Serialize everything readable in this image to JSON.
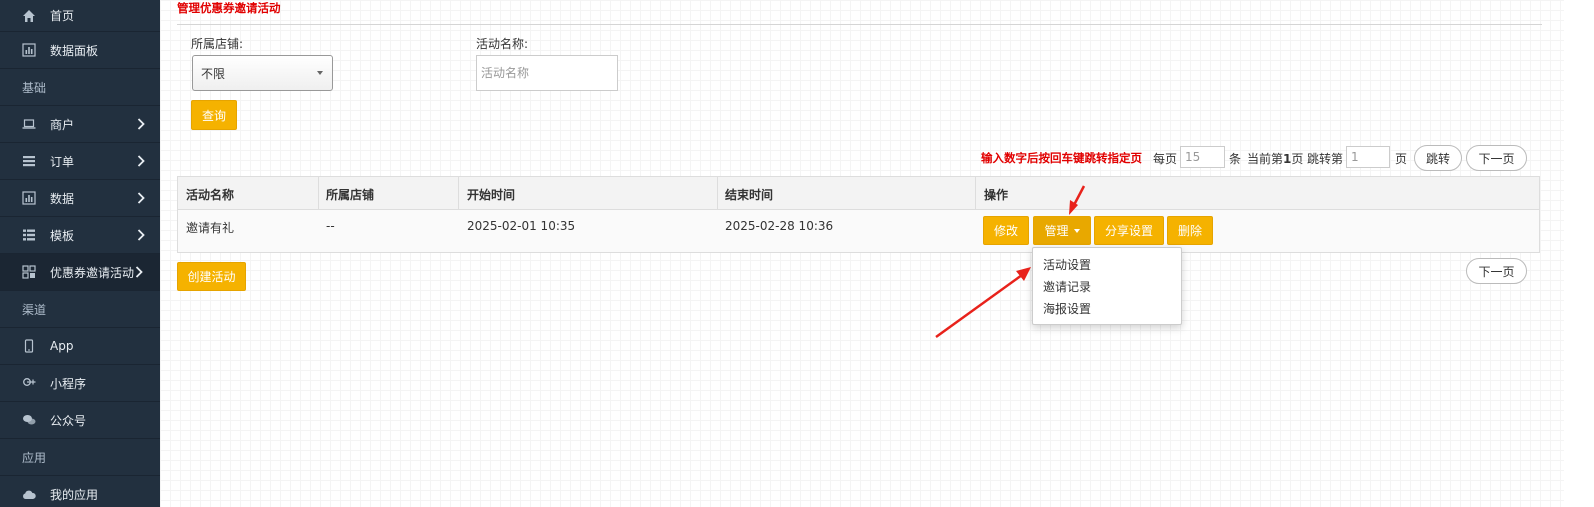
{
  "sidebar": {
    "items": [
      {
        "label": "首页",
        "icon": "home-icon"
      },
      {
        "label": "数据面板",
        "icon": "bar-chart-icon"
      },
      {
        "section": "基础"
      },
      {
        "label": "商户",
        "icon": "laptop-icon"
      },
      {
        "label": "订单",
        "icon": "list-icon"
      },
      {
        "label": "数据",
        "icon": "bar-chart-icon"
      },
      {
        "label": "模板",
        "icon": "table-list-icon"
      },
      {
        "label": "优惠券邀请活动",
        "icon": "grid-icon"
      },
      {
        "section": "渠道"
      },
      {
        "label": "App",
        "icon": "mobile-icon"
      },
      {
        "label": "小程序",
        "icon": "google-plus-icon"
      },
      {
        "label": "公众号",
        "icon": "chat-bubbles-icon"
      },
      {
        "section": "应用"
      },
      {
        "label": "我的应用",
        "icon": "cloud-icon"
      }
    ]
  },
  "page": {
    "title": "管理优惠券邀请活动"
  },
  "filters": {
    "store_label": "所属店铺:",
    "store_value": "不限",
    "activity_label": "活动名称:",
    "activity_placeholder": "活动名称",
    "query_button": "查询"
  },
  "pager": {
    "hint": "输入数字后按回车键跳转指定页",
    "per_page_prefix": "每页",
    "per_page_value": "15",
    "per_page_suffix": "条",
    "current_prefix": "当前第",
    "current_page": "1",
    "current_suffix": "页",
    "jump_prefix": "跳转第",
    "jump_value": "1",
    "jump_suffix": "页",
    "jump_button": "跳转",
    "next_button": "下一页"
  },
  "table": {
    "headers": [
      "活动名称",
      "所属店铺",
      "开始时间",
      "结束时间",
      "操作"
    ],
    "rows": [
      {
        "name": "邀请有礼",
        "store": "--",
        "start": "2025-02-01 10:35",
        "end": "2025-02-28 10:36",
        "actions": {
          "edit": "修改",
          "manage": "管理",
          "share": "分享设置",
          "delete": "删除"
        }
      }
    ]
  },
  "manage_menu": {
    "items": [
      "活动设置",
      "邀请记录",
      "海报设置"
    ]
  },
  "footer": {
    "create_button": "创建活动",
    "next_button": "下一页"
  },
  "colors": {
    "sidebar_bg": "#22303f",
    "accent_yellow": "#f5b200",
    "hint_red": "#e10000",
    "arrow_red": "#e8221b"
  }
}
